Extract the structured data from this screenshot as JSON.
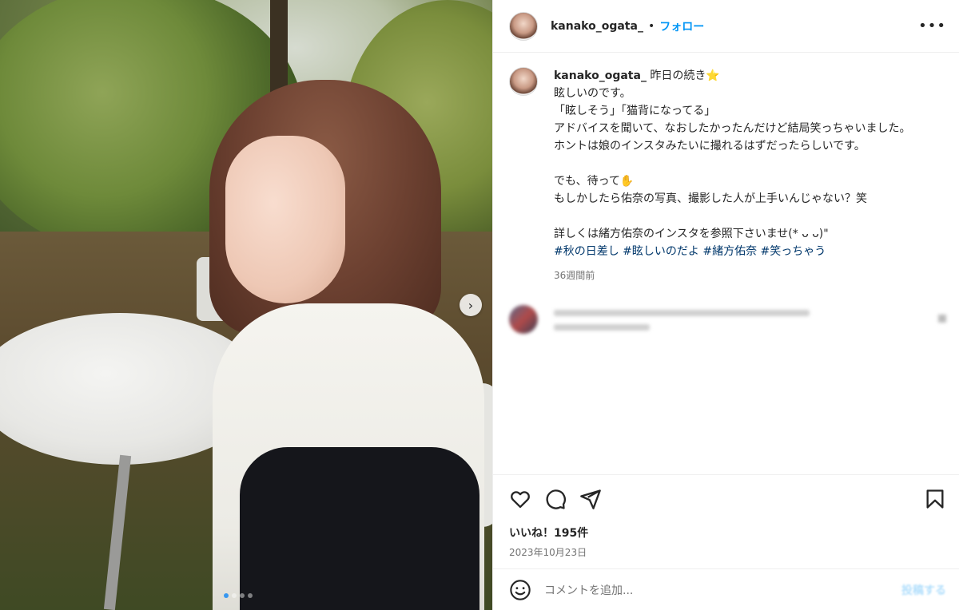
{
  "post": {
    "username": "kanako_ogata_",
    "separator": "•",
    "follow_label": "フォロー",
    "more_label": "•••",
    "caption_first": " 昨日の続き⭐",
    "caption_body": "眩しいのです。\n「眩しそう」「猫背になってる」\nアドバイスを聞いて、なおしたかったんだけど結局笑っちゃいました。\nホントは娘のインスタみたいに撮れるはずだったらしいです。\n\nでも、待って✋\nもしかしたら佑奈の写真、撮影した人が上手いんじゃない？笑\n\n詳しくは緒方佑奈のインスタを参照下さいませ(* ᴗ ᴗ)\"\n",
    "hashtags": "#秋の日差し #眩しいのだよ #緒方佑奈 #笑っちゃう",
    "time_ago": "36週間前",
    "likes": "いいね！195件",
    "date": "2023年10月23日",
    "comment_placeholder": "コメントを追加...",
    "post_label": "投稿する"
  },
  "media": {
    "slide_count": 4,
    "active_slide": 1,
    "next_label": "›"
  },
  "icons": [
    "heart-icon",
    "comment-icon",
    "share-icon",
    "bookmark-icon",
    "emoji-icon"
  ],
  "colors": {
    "accent": "#0095f6",
    "hashtag": "#00376b",
    "muted": "#737373"
  }
}
